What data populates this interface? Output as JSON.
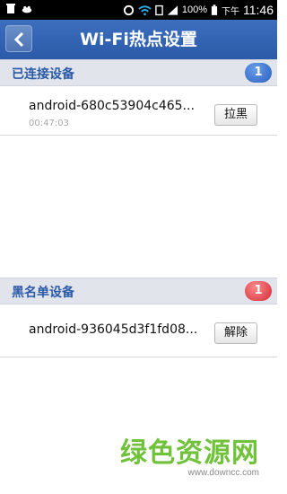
{
  "status_bar": {
    "battery": "100%",
    "period": "下午",
    "time": "11:46"
  },
  "header": {
    "title": "Wi-Fi热点设置",
    "back_icon": "chevron-left-icon"
  },
  "connected_section": {
    "title": "已连接设备",
    "count": "1",
    "devices": [
      {
        "name": "android-680c53904c465...",
        "duration": "00:47:03",
        "action": "拉黑"
      }
    ]
  },
  "blacklist_section": {
    "title": "黑名单设备",
    "count": "1",
    "devices": [
      {
        "name": "android-936045d3f1fd08...",
        "action": "解除"
      }
    ]
  },
  "watermark": {
    "text": "绿色资源网",
    "url": "www.downcc.com"
  },
  "colors": {
    "header": "#2a5aa8",
    "section_bg": "#e1e4ea",
    "badge_blue": "#2a5ec0",
    "badge_red": "#d12a3a",
    "watermark": "#6fc23a"
  }
}
